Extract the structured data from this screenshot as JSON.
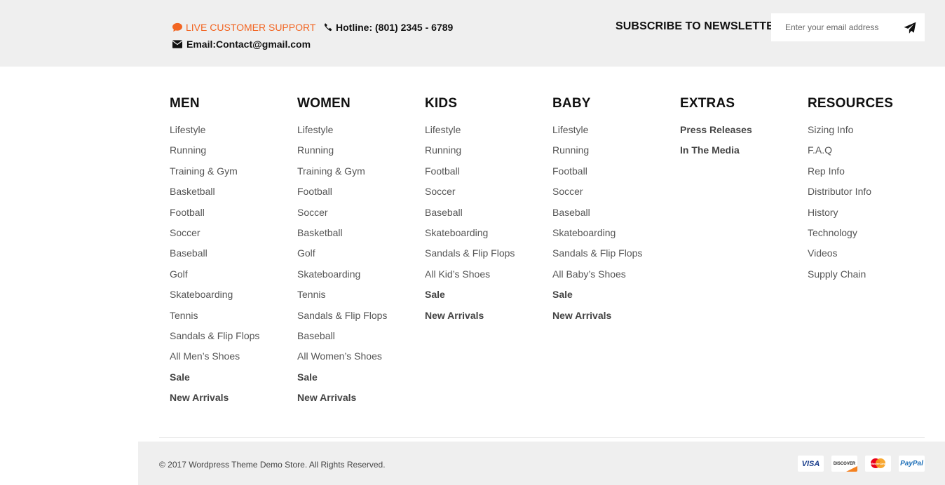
{
  "topbar": {
    "support_label": "LIVE CUSTOMER SUPPORT",
    "hotline_label": "Hotline: (801) 2345 - 6789",
    "email_label": "Email:Contact@gmail.com",
    "subscribe_title": "SUBSCRIBE TO NEWSLETTER",
    "subscribe_placeholder": "Enter your email address",
    "support_color": "#f26522",
    "background_color": "#efefef"
  },
  "columns": [
    {
      "title": "MEN",
      "items": [
        {
          "label": "Lifestyle",
          "bold": false
        },
        {
          "label": "Running",
          "bold": false
        },
        {
          "label": "Training & Gym",
          "bold": false
        },
        {
          "label": "Basketball",
          "bold": false
        },
        {
          "label": "Football",
          "bold": false
        },
        {
          "label": "Soccer",
          "bold": false
        },
        {
          "label": "Baseball",
          "bold": false
        },
        {
          "label": "Golf",
          "bold": false
        },
        {
          "label": "Skateboarding",
          "bold": false
        },
        {
          "label": "Tennis",
          "bold": false
        },
        {
          "label": "Sandals & Flip Flops",
          "bold": false
        },
        {
          "label": "All Men’s Shoes",
          "bold": false
        },
        {
          "label": "Sale",
          "bold": true
        },
        {
          "label": "New Arrivals",
          "bold": true
        }
      ]
    },
    {
      "title": "WOMEN",
      "items": [
        {
          "label": "Lifestyle",
          "bold": false
        },
        {
          "label": "Running",
          "bold": false
        },
        {
          "label": "Training & Gym",
          "bold": false
        },
        {
          "label": "Football",
          "bold": false
        },
        {
          "label": "Soccer",
          "bold": false
        },
        {
          "label": "Basketball",
          "bold": false
        },
        {
          "label": "Golf",
          "bold": false
        },
        {
          "label": "Skateboarding",
          "bold": false
        },
        {
          "label": "Tennis",
          "bold": false
        },
        {
          "label": "Sandals & Flip Flops",
          "bold": false
        },
        {
          "label": "Baseball",
          "bold": false
        },
        {
          "label": "All Women’s Shoes",
          "bold": false
        },
        {
          "label": "Sale",
          "bold": true
        },
        {
          "label": "New Arrivals",
          "bold": true
        }
      ]
    },
    {
      "title": "KIDS",
      "items": [
        {
          "label": "Lifestyle",
          "bold": false
        },
        {
          "label": "Running",
          "bold": false
        },
        {
          "label": "Football",
          "bold": false
        },
        {
          "label": "Soccer",
          "bold": false
        },
        {
          "label": "Baseball",
          "bold": false
        },
        {
          "label": "Skateboarding",
          "bold": false
        },
        {
          "label": "Sandals & Flip Flops",
          "bold": false
        },
        {
          "label": "All Kid’s Shoes",
          "bold": false
        },
        {
          "label": "Sale",
          "bold": true
        },
        {
          "label": "New Arrivals",
          "bold": true
        }
      ]
    },
    {
      "title": "BABY",
      "items": [
        {
          "label": "Lifestyle",
          "bold": false
        },
        {
          "label": "Running",
          "bold": false
        },
        {
          "label": "Football",
          "bold": false
        },
        {
          "label": "Soccer",
          "bold": false
        },
        {
          "label": "Baseball",
          "bold": false
        },
        {
          "label": "Skateboarding",
          "bold": false
        },
        {
          "label": "Sandals & Flip Flops",
          "bold": false
        },
        {
          "label": "All Baby’s Shoes",
          "bold": false
        },
        {
          "label": "Sale",
          "bold": true
        },
        {
          "label": "New Arrivals",
          "bold": true
        }
      ]
    },
    {
      "title": "EXTRAS",
      "items": [
        {
          "label": "Press Releases",
          "bold": true
        },
        {
          "label": "In The Media",
          "bold": true
        }
      ]
    },
    {
      "title": "RESOURCES",
      "items": [
        {
          "label": "Sizing Info",
          "bold": false
        },
        {
          "label": "F.A.Q",
          "bold": false
        },
        {
          "label": "Rep Info",
          "bold": false
        },
        {
          "label": "Distributor Info",
          "bold": false
        },
        {
          "label": "History",
          "bold": false
        },
        {
          "label": "Technology",
          "bold": false
        },
        {
          "label": "Videos",
          "bold": false
        },
        {
          "label": "Supply Chain",
          "bold": false
        }
      ]
    }
  ],
  "footer": {
    "copyright_prefix": "© 2017 ",
    "copyright_link": "Wordpress Theme Demo Store",
    "copyright_suffix": ". All Rights Reserved.",
    "payments": [
      {
        "icon": "visa-icon",
        "label": "VISA"
      },
      {
        "icon": "discover-icon",
        "label": "DISCOVER"
      },
      {
        "icon": "mastercard-icon",
        "label": "MasterCard"
      },
      {
        "icon": "paypal-icon",
        "label": "PayPal"
      }
    ]
  }
}
